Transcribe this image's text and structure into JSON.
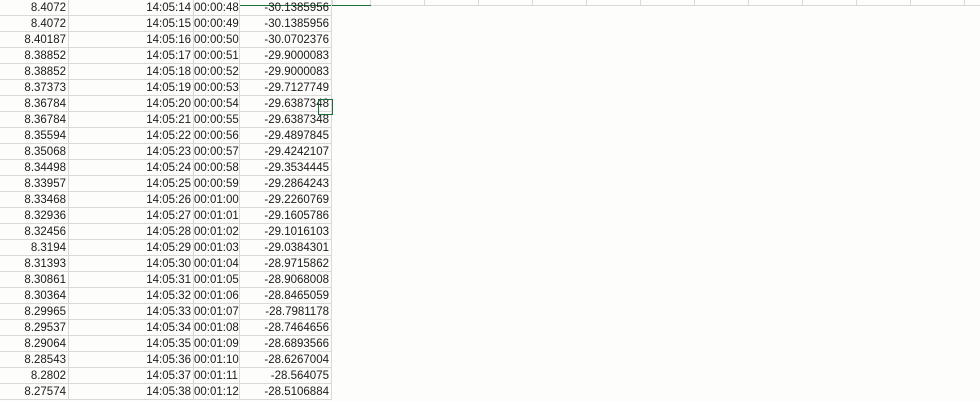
{
  "sheet": {
    "rows": [
      [
        "8.4072",
        "14:05:14",
        "00:00:48",
        "-30.1385956"
      ],
      [
        "8.4072",
        "14:05:15",
        "00:00:49",
        "-30.1385956"
      ],
      [
        "8.40187",
        "14:05:16",
        "00:00:50",
        "-30.0702376"
      ],
      [
        "8.38852",
        "14:05:17",
        "00:00:51",
        "-29.9000083"
      ],
      [
        "8.38852",
        "14:05:18",
        "00:00:52",
        "-29.9000083"
      ],
      [
        "8.37373",
        "14:05:19",
        "00:00:53",
        "-29.7127749"
      ],
      [
        "8.36784",
        "14:05:20",
        "00:00:54",
        "-29.6387348"
      ],
      [
        "8.36784",
        "14:05:21",
        "00:00:55",
        "-29.6387348"
      ],
      [
        "8.35594",
        "14:05:22",
        "00:00:56",
        "-29.4897845"
      ],
      [
        "8.35068",
        "14:05:23",
        "00:00:57",
        "-29.4242107"
      ],
      [
        "8.34498",
        "14:05:24",
        "00:00:58",
        "-29.3534445"
      ],
      [
        "8.33957",
        "14:05:25",
        "00:00:59",
        "-29.2864243"
      ],
      [
        "8.33468",
        "14:05:26",
        "00:01:00",
        "-29.2260769"
      ],
      [
        "8.32936",
        "14:05:27",
        "00:01:01",
        "-29.1605786"
      ],
      [
        "8.32456",
        "14:05:28",
        "00:01:02",
        "-29.1016103"
      ],
      [
        "8.3194",
        "14:05:29",
        "00:01:03",
        "-29.0384301"
      ],
      [
        "8.31393",
        "14:05:30",
        "00:01:04",
        "-28.9715862"
      ],
      [
        "8.30861",
        "14:05:31",
        "00:01:05",
        "-28.9068008"
      ],
      [
        "8.30364",
        "14:05:32",
        "00:01:06",
        "-28.8465059"
      ],
      [
        "8.29965",
        "14:05:33",
        "00:01:07",
        "-28.7981178"
      ],
      [
        "8.29537",
        "14:05:34",
        "00:01:08",
        "-28.7464656"
      ],
      [
        "8.29064",
        "14:05:35",
        "00:01:09",
        "-28.6893566"
      ],
      [
        "8.28543",
        "14:05:36",
        "00:01:10",
        "-28.6267004"
      ],
      [
        "8.2802",
        "14:05:37",
        "00:01:11",
        "-28.564075"
      ],
      [
        "8.27574",
        "14:05:38",
        "00:01:12",
        "-28.5106884"
      ]
    ]
  },
  "colors": {
    "gridline": "#d9d9d9",
    "selection": "#1f6b3a",
    "background": "#fdfdfb"
  }
}
